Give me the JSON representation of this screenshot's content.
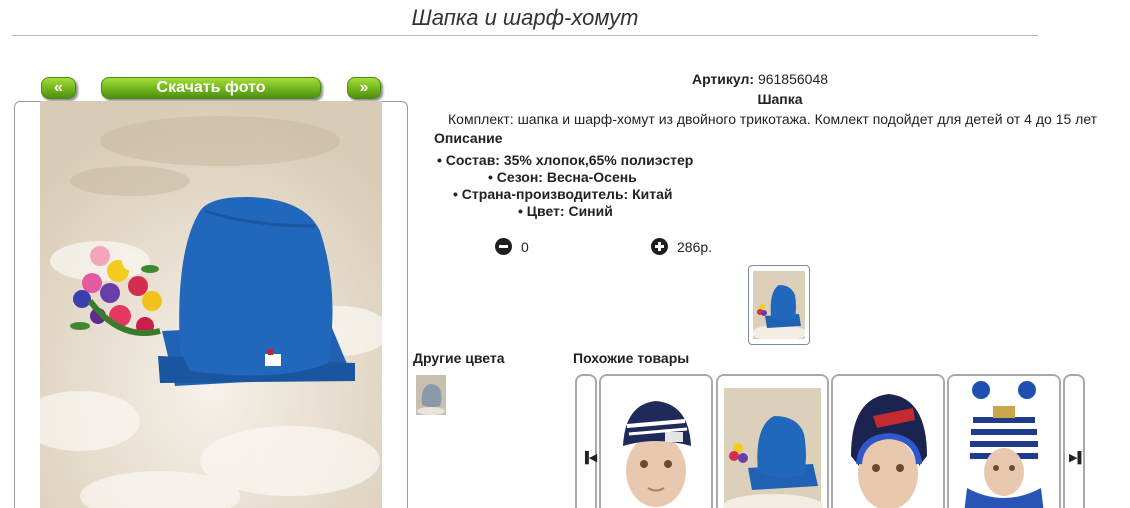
{
  "page": {
    "title": "Шапка и шарф-хомут"
  },
  "gallery": {
    "prev_label": "«",
    "download_label": "Скачать фото",
    "next_label": "»"
  },
  "product": {
    "article_label": "Артикул:",
    "article_value": "961856048",
    "name": "Шапка",
    "short_description": "Комплект: шапка и шарф-хомут из двойного трикотажа. Комлект подойдет для детей от 4 до 15 лет",
    "description_heading": "Описание",
    "specs": [
      "Состав: 35% хлопок,65% полиэстер",
      "Сезон: Весна-Осень",
      "Страна-производитель: Китай",
      "Цвет: Синий"
    ]
  },
  "cart": {
    "quantity": "0",
    "price": "286р."
  },
  "sections": {
    "other_colors": "Другие цвета",
    "similar": "Похожие товары"
  },
  "icons": [
    "minus-circle-icon",
    "plus-circle-icon",
    "arrow-left-icon",
    "arrow-right-icon"
  ],
  "colors": {
    "button_green": "#6fb51a",
    "hat_blue": "#1f62b4"
  }
}
